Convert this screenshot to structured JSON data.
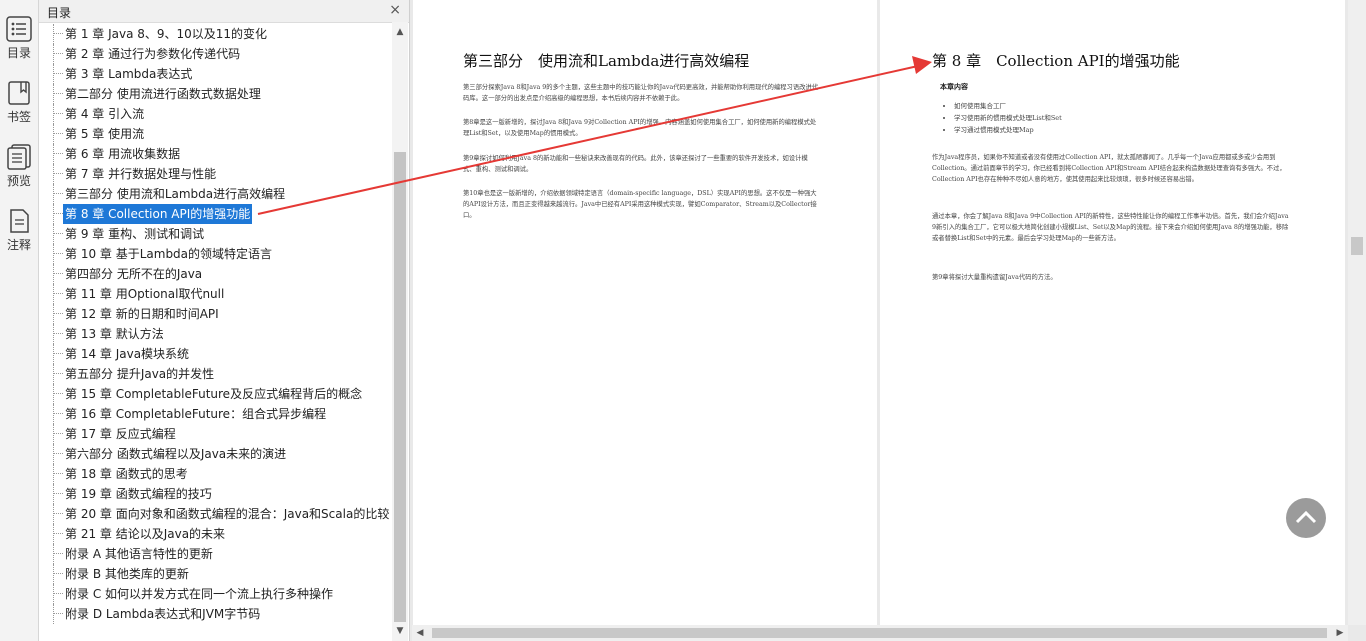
{
  "rail": {
    "items": [
      {
        "label": "目录",
        "icon": "toc-list-icon"
      },
      {
        "label": "书签",
        "icon": "bookmark-icon"
      },
      {
        "label": "预览",
        "icon": "preview-icon"
      },
      {
        "label": "注释",
        "icon": "annotation-icon"
      }
    ]
  },
  "toc": {
    "title": "目录",
    "close": "×",
    "items": [
      {
        "label": "第 1 章 Java 8、9、10以及11的变化"
      },
      {
        "label": "第 2 章 通过行为参数化传递代码"
      },
      {
        "label": "第 3 章 Lambda表达式"
      },
      {
        "label": "第二部分 使用流进行函数式数据处理"
      },
      {
        "label": "第 4 章 引入流"
      },
      {
        "label": "第 5 章 使用流"
      },
      {
        "label": "第 6 章 用流收集数据"
      },
      {
        "label": "第 7 章 并行数据处理与性能"
      },
      {
        "label": "第三部分 使用流和Lambda进行高效编程"
      },
      {
        "label": "第 8 章 Collection API的增强功能",
        "selected": true
      },
      {
        "label": "第 9 章 重构、测试和调试"
      },
      {
        "label": "第 10 章 基于Lambda的领域特定语言"
      },
      {
        "label": "第四部分 无所不在的Java"
      },
      {
        "label": "第 11 章 用Optional取代null"
      },
      {
        "label": "第 12 章 新的日期和时间API"
      },
      {
        "label": "第 13 章 默认方法"
      },
      {
        "label": "第 14 章 Java模块系统"
      },
      {
        "label": "第五部分 提升Java的并发性"
      },
      {
        "label": "第 15 章 CompletableFuture及反应式编程背后的概念"
      },
      {
        "label": "第 16 章 CompletableFuture：组合式异步编程"
      },
      {
        "label": "第 17 章 反应式编程"
      },
      {
        "label": "第六部分 函数式编程以及Java未来的演进"
      },
      {
        "label": "第 18 章 函数式的思考"
      },
      {
        "label": "第 19 章 函数式编程的技巧"
      },
      {
        "label": "第 20 章 面向对象和函数式编程的混合：Java和Scala的比较"
      },
      {
        "label": "第 21 章 结论以及Java的未来"
      },
      {
        "label": "附录 A 其他语言特性的更新"
      },
      {
        "label": "附录 B 其他类库的更新"
      },
      {
        "label": "附录 C 如何以并发方式在同一个流上执行多种操作"
      },
      {
        "label": "附录 D Lambda表达式和JVM字节码"
      }
    ]
  },
  "left_page": {
    "title": "第三部分　使用流和Lambda进行高效编程",
    "paragraphs": [
      "第三部分探索Java 8和Java 9的多个主题，这些主题中的技巧能让你的Java代码更高效，并能帮助你利用现代的编程习语改进代码库。这一部分的出发点是介绍高级的编程思想，本书后续内容并不依赖于此。",
      "第8章是这一版新增的，探讨Java 8和Java 9对Collection API的增强。内容涵盖如何使用集合工厂，如何使用新的编程模式处理List和Set，以及使用Map的惯用模式。",
      "第9章探讨如何利用Java 8的新功能和一些秘诀来改善现有的代码。此外，该章还探讨了一些重要的软件开发技术，如设计模式、重构、测试和调试。",
      "第10章也是这一版新增的，介绍依据领域特定语言（domain-specific language，DSL）实现API的思想。这不仅是一种强大的API设计方法，而且正变得越来越流行。Java中已经有API采用这种模式实现，譬如Comparator、Stream以及Collector接口。"
    ]
  },
  "right_page": {
    "title": "第 8 章　Collection API的增强功能",
    "section": "本章内容",
    "bullets": [
      "如何使用集合工厂",
      "学习使用新的惯用模式处理List和Set",
      "学习通过惯用模式处理Map"
    ],
    "paragraphs": [
      "作为Java程序员，如果你不知道或者没有使用过Collection API，就太孤陋寡闻了。几乎每一个Java应用都或多或少会用到Collection。通过前面章节的学习，你已经看到将Collection API和Stream API结合起来构造数据处理查询有多强大。不过，Collection API也存在种种不尽如人意的地方，使其使用起来比较烦琐，很多时候还容易出错。",
      "通过本章，你会了解Java 8和Java 9中Collection API的新特性，这些特性能让你的编程工作事半功倍。首先，我们会介绍Java 9新引入的集合工厂，它可以极大地简化创建小规模List、Set以及Map的流程。接下来会介绍如何使用Java 8的增强功能，移除或者替换List和Set中的元素。最后会学习处理Map的一些新方法。",
      "第9章将探讨大量重构遗留Java代码的方法。"
    ]
  },
  "colors": {
    "selection": "#1e78d7",
    "arrow": "#e53935",
    "scroll_top_button": "#9b9b9b"
  }
}
